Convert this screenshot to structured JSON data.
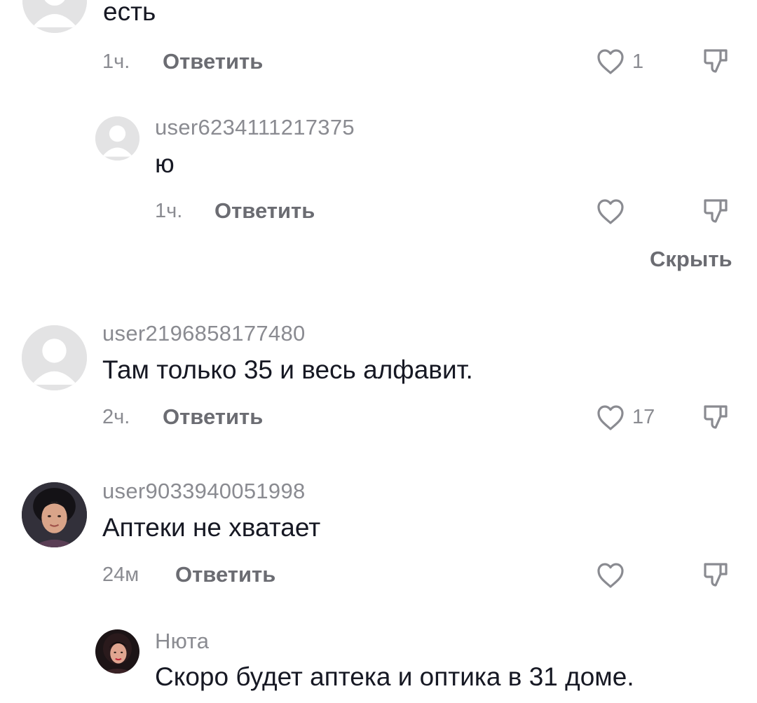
{
  "comments": [
    {
      "text": "есть",
      "time": "1ч.",
      "reply_label": "Ответить",
      "like_count": "1",
      "avatar": "default-avatar"
    },
    {
      "username": "user6234111217375",
      "text": "ю",
      "time": "1ч.",
      "reply_label": "Ответить",
      "avatar": "default-avatar"
    },
    {
      "username": "user2196858177480",
      "text": "Там только 35 и весь алфавит.",
      "time": "2ч.",
      "reply_label": "Ответить",
      "like_count": "17",
      "avatar": "default-avatar"
    },
    {
      "username": "user9033940051998",
      "text": "Аптеки не хватает",
      "time": "24м",
      "reply_label": "Ответить",
      "avatar": "photo-avatar-woman"
    },
    {
      "username": "Нюта",
      "text": "Скоро будет аптека и оптика в 31 доме.",
      "avatar": "photo-avatar-woman"
    }
  ],
  "hide_replies_label": "Скрыть",
  "icons": {
    "like": "heart-outline-icon",
    "dislike": "thumbs-down-icon"
  },
  "colors": {
    "primary_text": "#161823",
    "secondary_text": "#8a8b91",
    "action_text": "#6b6c72",
    "default_avatar_bg": "#e3e3e4"
  }
}
